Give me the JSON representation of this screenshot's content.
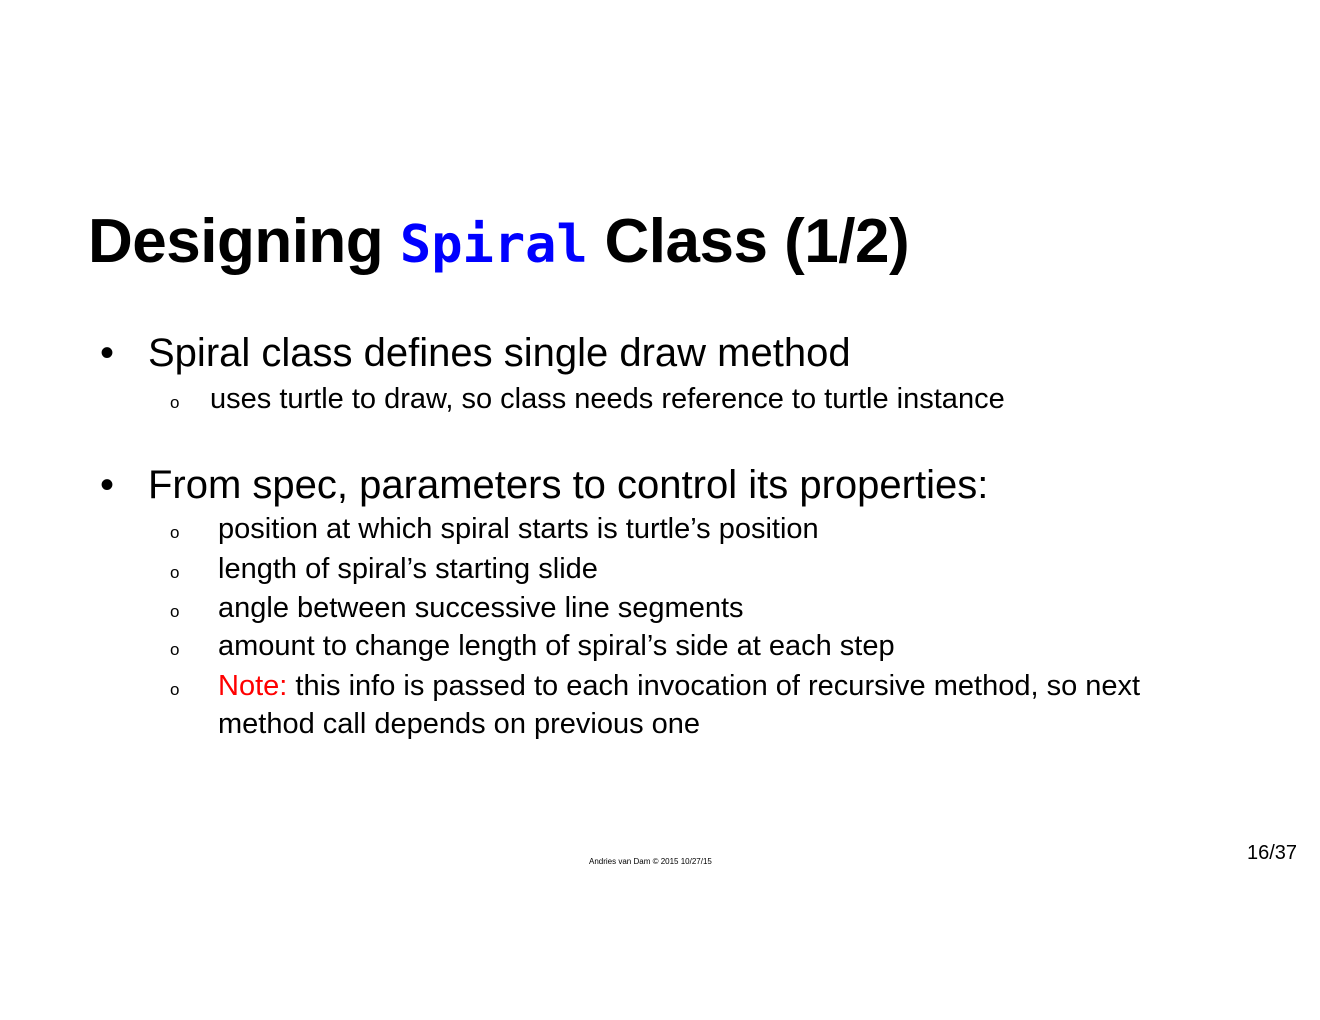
{
  "slide": {
    "title": {
      "prefix": "Designing ",
      "code": "Spiral",
      "suffix": " Class (1/2)",
      "code_color": "#0000ff"
    },
    "bullets": [
      {
        "marker": "•",
        "text": "Spiral class defines single draw method",
        "sub": [
          {
            "marker": "o",
            "text": "uses turtle to draw, so class needs reference to turtle instance"
          }
        ]
      },
      {
        "marker": "•",
        "text": "From spec, parameters to control its properties:",
        "sub": [
          {
            "marker": "o",
            "text": "position at which spiral starts is turtle’s position"
          },
          {
            "marker": "o",
            "text": "length of spiral’s starting slide"
          },
          {
            "marker": "o",
            "text": "angle between successive line segments"
          },
          {
            "marker": "o",
            "text": "amount to change length of spiral’s side at each step"
          },
          {
            "marker": "o",
            "note_label": "Note:",
            "note_color": "#ff0000",
            "text_line1": " this info is passed to each invocation of recursive method, so next",
            "text_line2": "method call depends on previous one"
          }
        ]
      }
    ],
    "footer": "Andries  van Dam  © 2015 10/27/15",
    "page_number": "16/37"
  }
}
